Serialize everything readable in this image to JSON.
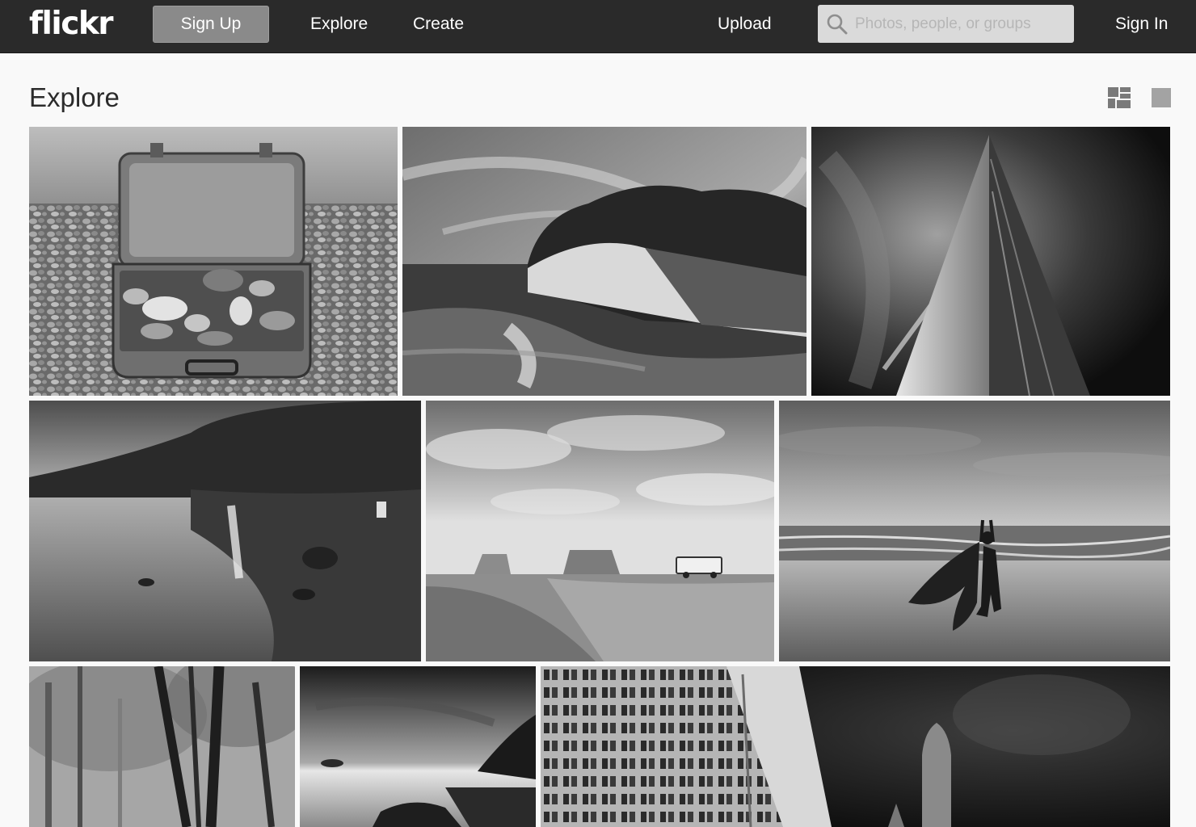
{
  "header": {
    "logo_text": "flickr",
    "signup_label": "Sign Up",
    "nav": {
      "explore": "Explore",
      "create": "Create",
      "upload": "Upload",
      "signin": "Sign In"
    },
    "search": {
      "placeholder": "Photos, people, or groups",
      "value": "",
      "icon": "search-icon"
    }
  },
  "page": {
    "title": "Explore",
    "view_toggle": {
      "justified_icon": "justified-grid-icon",
      "single_icon": "single-view-icon"
    }
  },
  "photos": [
    {
      "subject": "suitcase-of-pebbles"
    },
    {
      "subject": "coastal-cliff-waves"
    },
    {
      "subject": "skyscraper-night-sky"
    },
    {
      "subject": "lake-shore-night"
    },
    {
      "subject": "desert-bus-monument-valley"
    },
    {
      "subject": "beach-dancer-fabric"
    },
    {
      "subject": "foggy-forest"
    },
    {
      "subject": "sunset-coast-rocks"
    },
    {
      "subject": "gothic-cathedral-night"
    }
  ],
  "colors": {
    "topbar": "#2a2a2a",
    "signup_button": "#8a8a8a",
    "search_bg": "#dadada",
    "page_bg": "#f9f9f9"
  }
}
